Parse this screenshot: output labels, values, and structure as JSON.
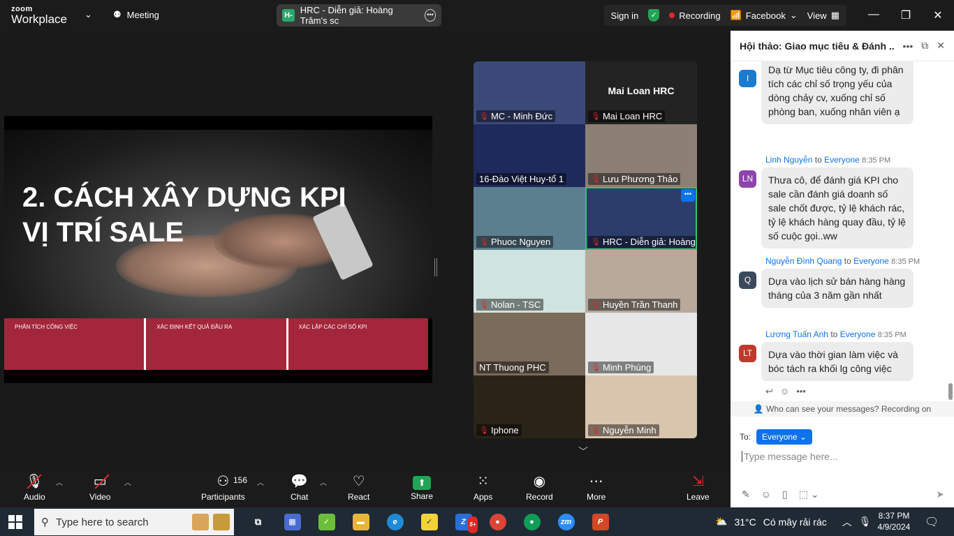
{
  "titlebar": {
    "logo_line1": "zoom",
    "logo_line2": "Workplace",
    "meeting_label": "Meeting",
    "tab_badge": "H-",
    "tab_title": "HRC - Diễn giả: Hoàng Trâm's sc",
    "signin": "Sign in",
    "recording": "Recording",
    "facebook": "Facebook",
    "view": "View"
  },
  "slide": {
    "title_line1": "2. CÁCH XÂY DỰNG KPI",
    "title_line2": "VỊ TRÍ SALE",
    "band": [
      "PHÂN TÍCH CÔNG VIỆC",
      "XÁC ĐỊNH KẾT QUẢ ĐẦU RA",
      "XÁC LẬP CÁC CHỈ SỐ KPI"
    ]
  },
  "participants_grid": [
    {
      "name": "MC - Minh Đức",
      "muted": true,
      "bg": "#3b4a7a"
    },
    {
      "name": "Mai Loan HRC",
      "muted": true,
      "bg": "#232323",
      "center_label": "Mai Loan HRC"
    },
    {
      "name": "16-Đào Việt Huy-tổ 1",
      "muted": false,
      "bg": "#1f2a5c"
    },
    {
      "name": "Lưu Phương Thảo",
      "muted": true,
      "bg": "#8c7f73"
    },
    {
      "name": "Phuoc Nguyen",
      "muted": true,
      "bg": "#5b7f8f"
    },
    {
      "name": "HRC - Diễn giả: Hoàng T...",
      "muted": true,
      "bg": "#2c3d6b",
      "active": true
    },
    {
      "name": "Nolan - TSC",
      "muted": true,
      "bg": "#cfe3df"
    },
    {
      "name": "Huyền Trần Thanh",
      "muted": true,
      "bg": "#b9a99b"
    },
    {
      "name": "NT Thuong PHC",
      "muted": false,
      "bg": "#7b6b5a"
    },
    {
      "name": "Minh Phùng",
      "muted": true,
      "bg": "#e7e7e7"
    },
    {
      "name": "Iphone",
      "muted": true,
      "bg": "#2a2418"
    },
    {
      "name": "Nguyễn Minh",
      "muted": true,
      "bg": "#d9c4ae"
    }
  ],
  "chat": {
    "title": "Hội thảo: Giao mục tiêu & Đánh ...",
    "messages": [
      {
        "avatar": "I",
        "color": "#1a7bd0",
        "sender": "",
        "to": "",
        "time": "",
        "text": "Dạ từ Mục tiêu công ty, đi phân tích các chỉ số trọng yếu của dòng chảy cv, xuống chỉ số phòng ban, xuống nhân viên ạ"
      },
      {
        "avatar": "LN",
        "color": "#8e44ad",
        "sender": "Linh Nguyễn",
        "to": "Everyone",
        "time": "8:35 PM",
        "text": "Thưa cô, để đánh giá KPI cho sale cần đánh giá doanh số sale chốt được, tỷ lệ khách rác, tỷ lệ khách hàng quay đầu, tỷ lệ số cuộc gọi..ww"
      },
      {
        "avatar": "Q",
        "color": "#3a4a5c",
        "sender": "Nguyễn Đình Quang",
        "to": "Everyone",
        "time": "8:35 PM",
        "text": "Dựa vào lịch sử bán hàng hàng tháng của 3 năm gần nhất"
      },
      {
        "avatar": "LT",
        "color": "#c0392b",
        "sender": "Lương Tuấn Anh",
        "to": "Everyone",
        "time": "8:35 PM",
        "text": "Dựa vào thời gian làm việc và bóc tách ra khối lg công việc"
      }
    ],
    "to_word": "to",
    "privacy_note": "Who can see your messages? Recording on",
    "to_label": "To:",
    "recipient": "Everyone",
    "placeholder": "Type message here..."
  },
  "toolbar": {
    "audio": "Audio",
    "video": "Video",
    "participants": "Participants",
    "participants_count": "156",
    "chat": "Chat",
    "react": "React",
    "share": "Share",
    "apps": "Apps",
    "record": "Record",
    "more": "More",
    "leave": "Leave"
  },
  "taskbar": {
    "search_placeholder": "Type here to search",
    "temperature": "31°C",
    "weather": "Có mây rải rác",
    "time": "8:37 PM",
    "date": "4/9/2024",
    "zoom_app": "zm",
    "badge": "5+"
  }
}
